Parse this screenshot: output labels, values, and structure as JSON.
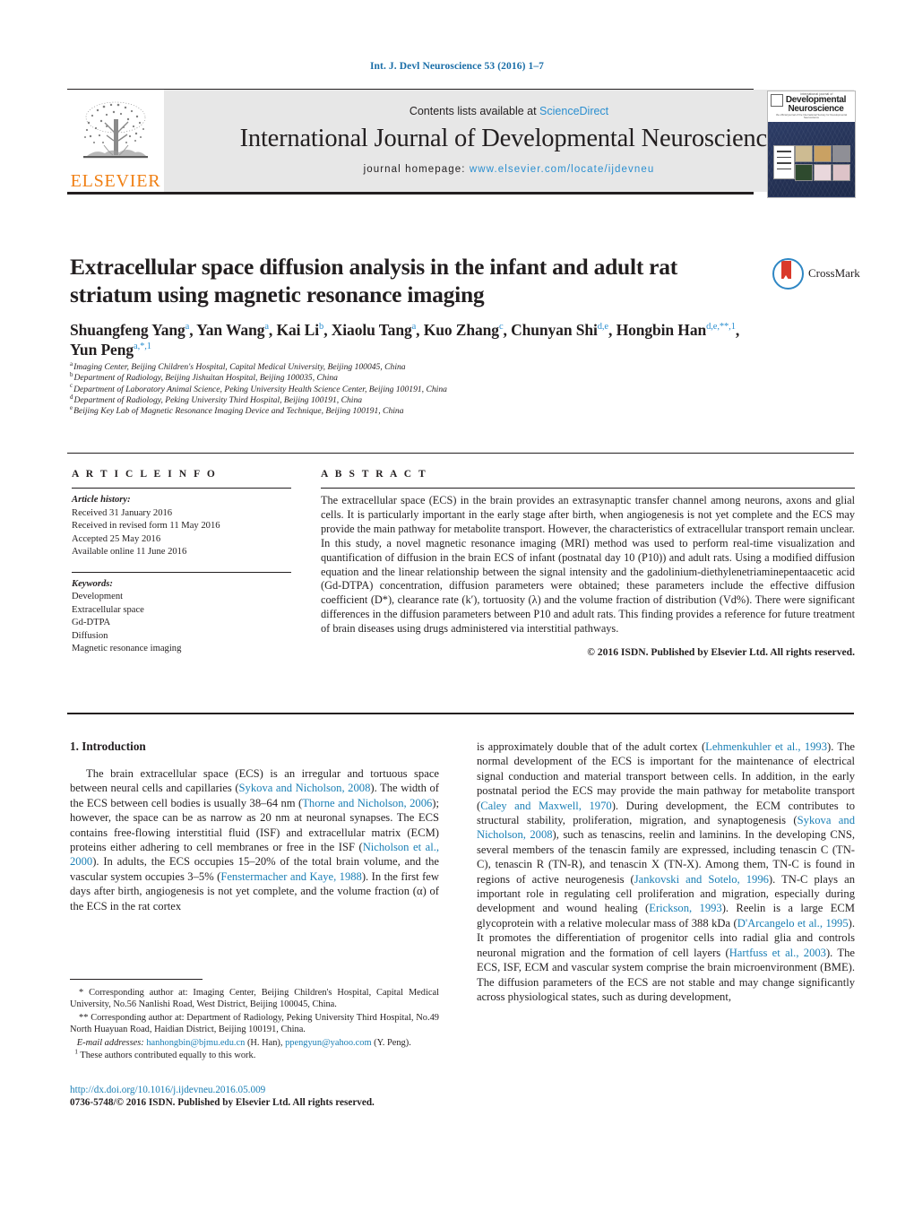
{
  "running_head": "Int. J. Devl Neuroscience 53 (2016) 1–7",
  "header": {
    "contents_prefix": "Contents lists available at ",
    "sciencedirect": "ScienceDirect",
    "journal_title": "International Journal of Developmental Neuroscience",
    "homepage_prefix": "journal homepage: ",
    "homepage_url": "www.elsevier.com/locate/ijdevneu",
    "publisher_logo_text": "ELSEVIER",
    "cover": {
      "top_line": "international journal of",
      "name_line1": "Developmental",
      "name_line2": "Neuroscience",
      "sub_line": "the official journal of the International Society for Developmental Neuroscience"
    }
  },
  "article": {
    "title_line1": "Extracellular space diffusion analysis in the infant and adult rat",
    "title_line2": "striatum using magnetic resonance imaging",
    "crossmark_label": "CrossMark",
    "authors": [
      {
        "name": "Shuangfeng Yang",
        "sup": "a",
        "sep": ", "
      },
      {
        "name": "Yan Wang",
        "sup": "a",
        "sep": ", "
      },
      {
        "name": "Kai Li",
        "sup": "b",
        "sep": ", "
      },
      {
        "name": "Xiaolu Tang",
        "sup": "a",
        "sep": ", "
      },
      {
        "name": "Kuo Zhang",
        "sup": "c",
        "sep": ", "
      },
      {
        "name": "Chunyan Shi",
        "sup": "d,e",
        "sep": ", "
      },
      {
        "name": "Hongbin Han",
        "sup": "d,e,**,1",
        "sep": ", "
      },
      {
        "name": "Yun Peng",
        "sup": "a,*,1",
        "sep": ""
      }
    ],
    "affiliations": [
      {
        "marker": "a",
        "text": "Imaging Center, Beijing Children's Hospital, Capital Medical University, Beijing 100045, China"
      },
      {
        "marker": "b",
        "text": "Department of Radiology, Beijing Jishuitan Hospital, Beijing 100035, China"
      },
      {
        "marker": "c",
        "text": "Department of Laboratory Animal Science, Peking University Health Science Center, Beijing 100191, China"
      },
      {
        "marker": "d",
        "text": "Department of Radiology, Peking University Third Hospital, Beijing 100191, China"
      },
      {
        "marker": "e",
        "text": "Beijing Key Lab of Magnetic Resonance Imaging Device and Technique, Beijing 100191, China"
      }
    ]
  },
  "article_info": {
    "heading": "A R T I C L E    I N F O",
    "history_label": "Article history:",
    "history": [
      "Received 31 January 2016",
      "Received in revised form 11 May 2016",
      "Accepted 25 May 2016",
      "Available online 11 June 2016"
    ],
    "keywords_label": "Keywords:",
    "keywords": [
      "Development",
      "Extracellular space",
      "Gd-DTPA",
      "Diffusion",
      "Magnetic resonance imaging"
    ]
  },
  "abstract": {
    "heading": "A B S T R A C T",
    "body": "The extracellular space (ECS) in the brain provides an extrasynaptic transfer channel among neurons, axons and glial cells. It is particularly important in the early stage after birth, when angiogenesis is not yet complete and the ECS may provide the main pathway for metabolite transport. However, the characteristics of extracellular transport remain unclear. In this study, a novel magnetic resonance imaging (MRI) method was used to perform real-time visualization and quantification of diffusion in the brain ECS of infant (postnatal day 10 (P10)) and adult rats. Using a modified diffusion equation and the linear relationship between the signal intensity and the gadolinium-diethylenetriaminepentaacetic acid (Gd-DTPA) concentration, diffusion parameters were obtained; these parameters include the effective diffusion coefficient (D*), clearance rate (k′), tortuosity (λ) and the volume fraction of distribution (Vd%). There were significant differences in the diffusion parameters between P10 and adult rats. This finding provides a reference for future treatment of brain diseases using drugs administered via interstitial pathways.",
    "copyright": "© 2016 ISDN. Published by Elsevier Ltd. All rights reserved."
  },
  "body": {
    "section_heading": "1. Introduction",
    "left_paragraph_parts": [
      {
        "t": "The brain extracellular space (ECS) is an irregular and tortuous space between neural cells and capillaries (",
        "c": false
      },
      {
        "t": "Sykova and Nicholson, 2008",
        "c": true
      },
      {
        "t": "). The width of the ECS between cell bodies is usually 38–64 nm (",
        "c": false
      },
      {
        "t": "Thorne and Nicholson, 2006",
        "c": true
      },
      {
        "t": "); however, the space can be as narrow as 20 nm at neuronal synapses. The ECS contains free-flowing interstitial fluid (ISF) and extracellular matrix (ECM) proteins either adhering to cell membranes or free in the ISF (",
        "c": false
      },
      {
        "t": "Nicholson et al., 2000",
        "c": true
      },
      {
        "t": "). In adults, the ECS occupies 15–20% of the total brain volume, and the vascular system occupies 3–5% (",
        "c": false
      },
      {
        "t": "Fenstermacher and Kaye, 1988",
        "c": true
      },
      {
        "t": "). In the first few days after birth, angiogenesis is not yet complete, and the volume fraction (α) of the ECS in the rat cortex",
        "c": false
      }
    ],
    "right_paragraph_parts": [
      {
        "t": "is approximately double that of the adult cortex (",
        "c": false
      },
      {
        "t": "Lehmenkuhler et al., 1993",
        "c": true
      },
      {
        "t": "). The normal development of the ECS is important for the maintenance of electrical signal conduction and material transport between cells. In addition, in the early postnatal period the ECS may provide the main pathway for metabolite transport (",
        "c": false
      },
      {
        "t": "Caley and Maxwell, 1970",
        "c": true
      },
      {
        "t": "). During development, the ECM contributes to structural stability, proliferation, migration, and synaptogenesis (",
        "c": false
      },
      {
        "t": "Sykova and Nicholson, 2008",
        "c": true
      },
      {
        "t": "), such as tenascins, reelin and laminins. In the developing CNS, several members of the tenascin family are expressed, including tenascin C (TN-C), tenascin R (TN-R), and tenascin X (TN-X). Among them, TN-C is found in regions of active neurogenesis (",
        "c": false
      },
      {
        "t": "Jankovski and Sotelo, 1996",
        "c": true
      },
      {
        "t": "). TN-C plays an important role in regulating cell proliferation and migration, especially during development and wound healing (",
        "c": false
      },
      {
        "t": "Erickson, 1993",
        "c": true
      },
      {
        "t": "). Reelin is a large ECM glycoprotein with a relative molecular mass of 388 kDa (",
        "c": false
      },
      {
        "t": "D'Arcangelo et al., 1995",
        "c": true
      },
      {
        "t": "). It promotes the differentiation of progenitor cells into radial glia and controls neuronal migration and the formation of cell layers (",
        "c": false
      },
      {
        "t": "Hartfuss et al., 2003",
        "c": true
      },
      {
        "t": "). The ECS, ISF, ECM and vascular system comprise the brain microenvironment (BME). The diffusion parameters of the ECS are not stable and may change significantly across physiological states, such as during development,",
        "c": false
      }
    ]
  },
  "footnotes": {
    "line1": "* Corresponding author at: Imaging Center, Beijing Children's Hospital, Capital Medical University, No.56 Nanlishi Road, West District, Beijing 100045, China.",
    "line2": "** Corresponding author at: Department of Radiology, Peking University Third Hospital, No.49 North Huayuan Road, Haidian District, Beijing 100191, China.",
    "email_label": "E-mail addresses:",
    "email1": "hanhongbin@bjmu.edu.cn",
    "email1_owner": "(H. Han),",
    "email2": "ppengyun@yahoo.com",
    "email2_owner": "(Y. Peng).",
    "equal_contrib_marker": "1",
    "equal_contrib": "These authors contributed equally to this work."
  },
  "bottom": {
    "doi": "http://dx.doi.org/10.1016/j.ijdevneu.2016.05.009",
    "issn_copyright": "0736-5748/© 2016 ISDN. Published by Elsevier Ltd. All rights reserved."
  },
  "colors": {
    "link": "#1a7fb5",
    "sciencedirect": "#2b8fd0",
    "elsevier_orange": "#f07f13",
    "text": "#231f20",
    "panel_bg": "#e7e7e7"
  }
}
